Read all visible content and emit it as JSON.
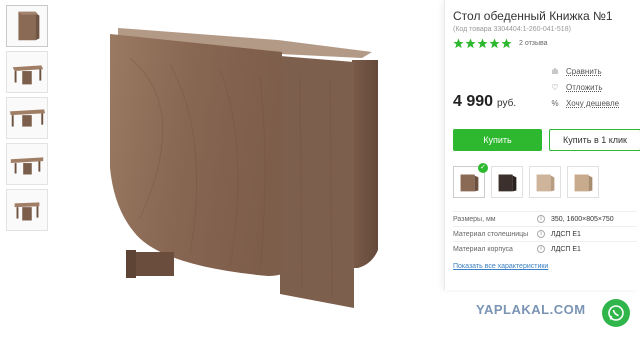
{
  "product": {
    "title": "Стол обеденный Книжка №1",
    "code": "(Код товара 3304404:1-260-041-518)",
    "rating": 5,
    "reviews": "2 отзыва"
  },
  "actions": [
    {
      "icon": "compare-icon",
      "glyph": "ılı",
      "label": "Сравнить"
    },
    {
      "icon": "heart-icon",
      "glyph": "♡",
      "label": "Отложить"
    },
    {
      "icon": "percent-icon",
      "glyph": "%",
      "label": "Хочу дешевле"
    }
  ],
  "price": {
    "amount": "4 990",
    "currency": "руб."
  },
  "buttons": {
    "buy": "Купить",
    "one_click": "Купить в 1 клик"
  },
  "specs": [
    {
      "key": "Размеры, мм",
      "value": "350, 1600×805×750"
    },
    {
      "key": "Материал столешницы",
      "value": "ЛДСП Е1"
    },
    {
      "key": "Материал корпуса",
      "value": "ЛДСП Е1"
    }
  ],
  "specs_link": "Показать все характеристики",
  "watermark": "YAPLAKAL.COM",
  "colors": {
    "accent_green": "#2eb830",
    "wood": "#8a6a55",
    "star": "#2eb830",
    "link": "#3a7fc4"
  }
}
